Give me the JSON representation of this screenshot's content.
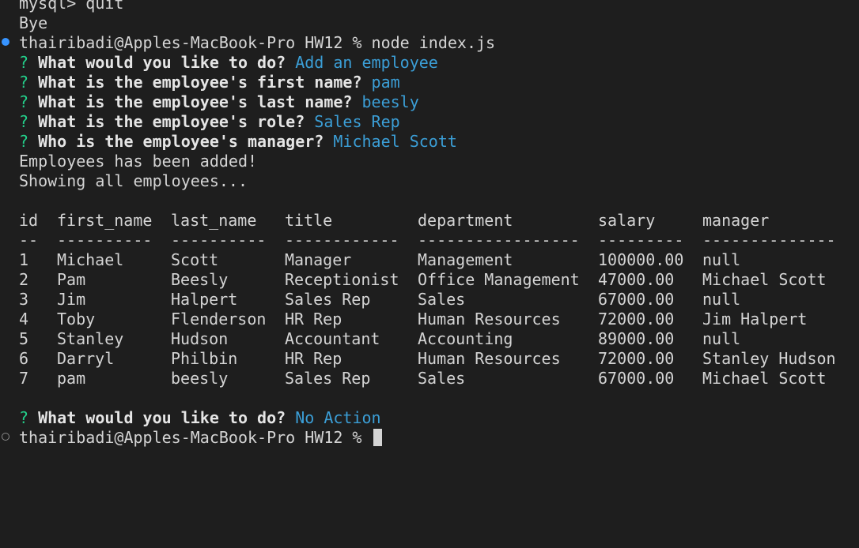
{
  "terminal": {
    "prev_prompt": "mysql> quit",
    "bye": "Bye",
    "shell_prompt": "thairibadi@Apples-MacBook-Pro HW12 % ",
    "command": "node index.js",
    "prompt_marker": "?",
    "questions": [
      {
        "label": "What would you like to do?",
        "answer": "Add an employee"
      },
      {
        "label": "What is the employee's first name?",
        "answer": "pam"
      },
      {
        "label": "What is the employee's last name?",
        "answer": "beesly"
      },
      {
        "label": "What is the employee's role?",
        "answer": "Sales Rep"
      },
      {
        "label": "Who is the employee's manager?",
        "answer": "Michael Scott"
      }
    ],
    "added_msg": "Employees has been added!",
    "showing_msg": "Showing all employees...",
    "table": {
      "headers": [
        "id",
        "first_name",
        "last_name",
        "title",
        "department",
        "salary",
        "manager"
      ],
      "separators": [
        "--",
        "----------",
        "----------",
        "------------",
        "-----------------",
        "---------",
        "--------------"
      ],
      "rows": [
        [
          "1",
          "Michael",
          "Scott",
          "Manager",
          "Management",
          "100000.00",
          "null"
        ],
        [
          "2",
          "Pam",
          "Beesly",
          "Receptionist",
          "Office Management",
          "47000.00",
          "Michael Scott"
        ],
        [
          "3",
          "Jim",
          "Halpert",
          "Sales Rep",
          "Sales",
          "67000.00",
          "null"
        ],
        [
          "4",
          "Toby",
          "Flenderson",
          "HR Rep",
          "Human Resources",
          "72000.00",
          "Jim Halpert"
        ],
        [
          "5",
          "Stanley",
          "Hudson",
          "Accountant",
          "Accounting",
          "89000.00",
          "null"
        ],
        [
          "6",
          "Darryl",
          "Philbin",
          "HR Rep",
          "Human Resources",
          "72000.00",
          "Stanley Hudson"
        ],
        [
          "7",
          "pam",
          "beesly",
          "Sales Rep",
          "Sales",
          "67000.00",
          "Michael Scott"
        ]
      ]
    },
    "final_question": {
      "label": "What would you like to do?",
      "answer": "No Action"
    },
    "colors": {
      "background": "#1e1e1e",
      "text": "#d4d4d4",
      "prompt_marker": "#23d18b",
      "answer": "#3b9ed6",
      "status_dot_active": "#3794ff"
    }
  }
}
